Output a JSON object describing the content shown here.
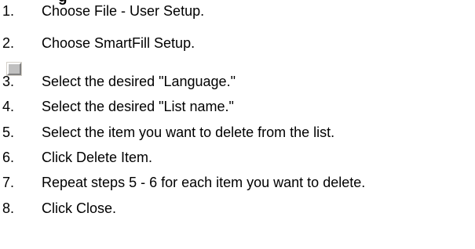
{
  "heading": "g",
  "steps": [
    {
      "num": "1.",
      "text": "Choose File - User Setup."
    },
    {
      "num": "2.",
      "text": "Choose SmartFill Setup."
    },
    {
      "num": "3.",
      "text": "Select the desired \"Language.\""
    },
    {
      "num": "4.",
      "text": "Select the desired \"List name.\""
    },
    {
      "num": "5.",
      "text": "Select the item you want to delete from the list."
    },
    {
      "num": "6.",
      "text": "Click Delete Item."
    },
    {
      "num": "7.",
      "text": "Repeat steps 5 - 6 for each item you want to delete."
    },
    {
      "num": "8.",
      "text": "Click Close."
    }
  ],
  "image_placeholder": {
    "icon": "missing-image-icon"
  }
}
